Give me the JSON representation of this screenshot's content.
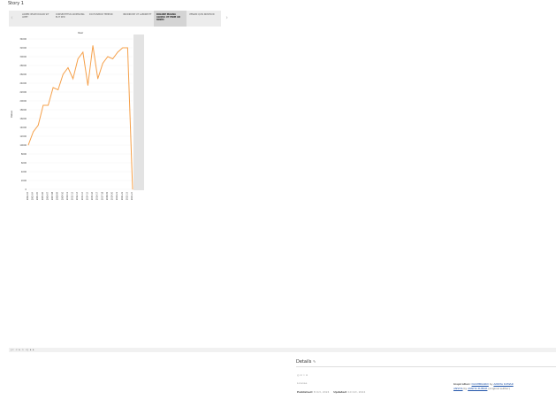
{
  "story": {
    "title": "Story 1"
  },
  "tabs": [
    {
      "label": "LOREM IPSUM DOLOR SIT AMET",
      "active": false
    },
    {
      "label": "CONSECTETUR ADIPISCING ELIT SED",
      "active": false
    },
    {
      "label": "DO EIUSMOD TEMPOR",
      "active": false
    },
    {
      "label": "INCIDIDUNT UT LABORE ET",
      "active": false
    },
    {
      "label": "DOLORE MAGNA ALIQUA UT ENIM AD MINIM",
      "active": true
    },
    {
      "label": "VENIAM QUIS NOSTRUD",
      "active": false
    }
  ],
  "chart_data": {
    "type": "line",
    "title": "Year",
    "ylabel": "Value",
    "color": "#f5a04a",
    "yticks": [
      "0",
      "2000",
      "4000",
      "6000",
      "8000",
      "10000",
      "12000",
      "14000",
      "16000",
      "18000",
      "20000",
      "22000",
      "24000",
      "26000",
      "28000",
      "30000",
      "32000",
      "34000"
    ],
    "ylim": [
      0,
      34000
    ],
    "x": [
      "2002-03",
      "2003-04",
      "2004-05",
      "2005-06",
      "2006-07",
      "2007-08",
      "2008-09",
      "2009-10",
      "2010-11",
      "2011-12",
      "2012-13",
      "2013-14",
      "2014-15",
      "2015-16",
      "2016-17",
      "2017-18",
      "2018-19",
      "2019-20",
      "2020-21",
      "2021-22",
      "2022-23",
      "2023-24"
    ],
    "values": [
      10000,
      13000,
      14500,
      19000,
      19000,
      23000,
      22500,
      26000,
      27500,
      25000,
      29500,
      31000,
      23500,
      32500,
      25000,
      28500,
      30000,
      29500,
      31000,
      32000,
      32000,
      0
    ]
  },
  "bottom_bar": {
    "text": "|< < ▸ > >|  ▸ ▸"
  },
  "details": {
    "header": "Details",
    "edit_icon": "pencil-icon",
    "views": "0",
    "views_icon": "eye-icon",
    "favorites": "0",
    "favorites_icon": "star-icon",
    "license_label": "License",
    "published_label": "Published:",
    "published_value": "8 Oct, 2024",
    "updated_label": "Updated:",
    "updated_value": "10 Oct, 2024",
    "inspiration_label": "Inspiration:",
    "inspiration_link1": "DASHBOARD",
    "inspiration_by1": "by",
    "inspiration_author1": "ANSHA KUMAR",
    "inspiration_link2": "ANSHA",
    "inspiration_by2": "by",
    "inspiration_author2": "ANSHA KUMAR",
    "inspiration_suffix": "(original author)"
  }
}
